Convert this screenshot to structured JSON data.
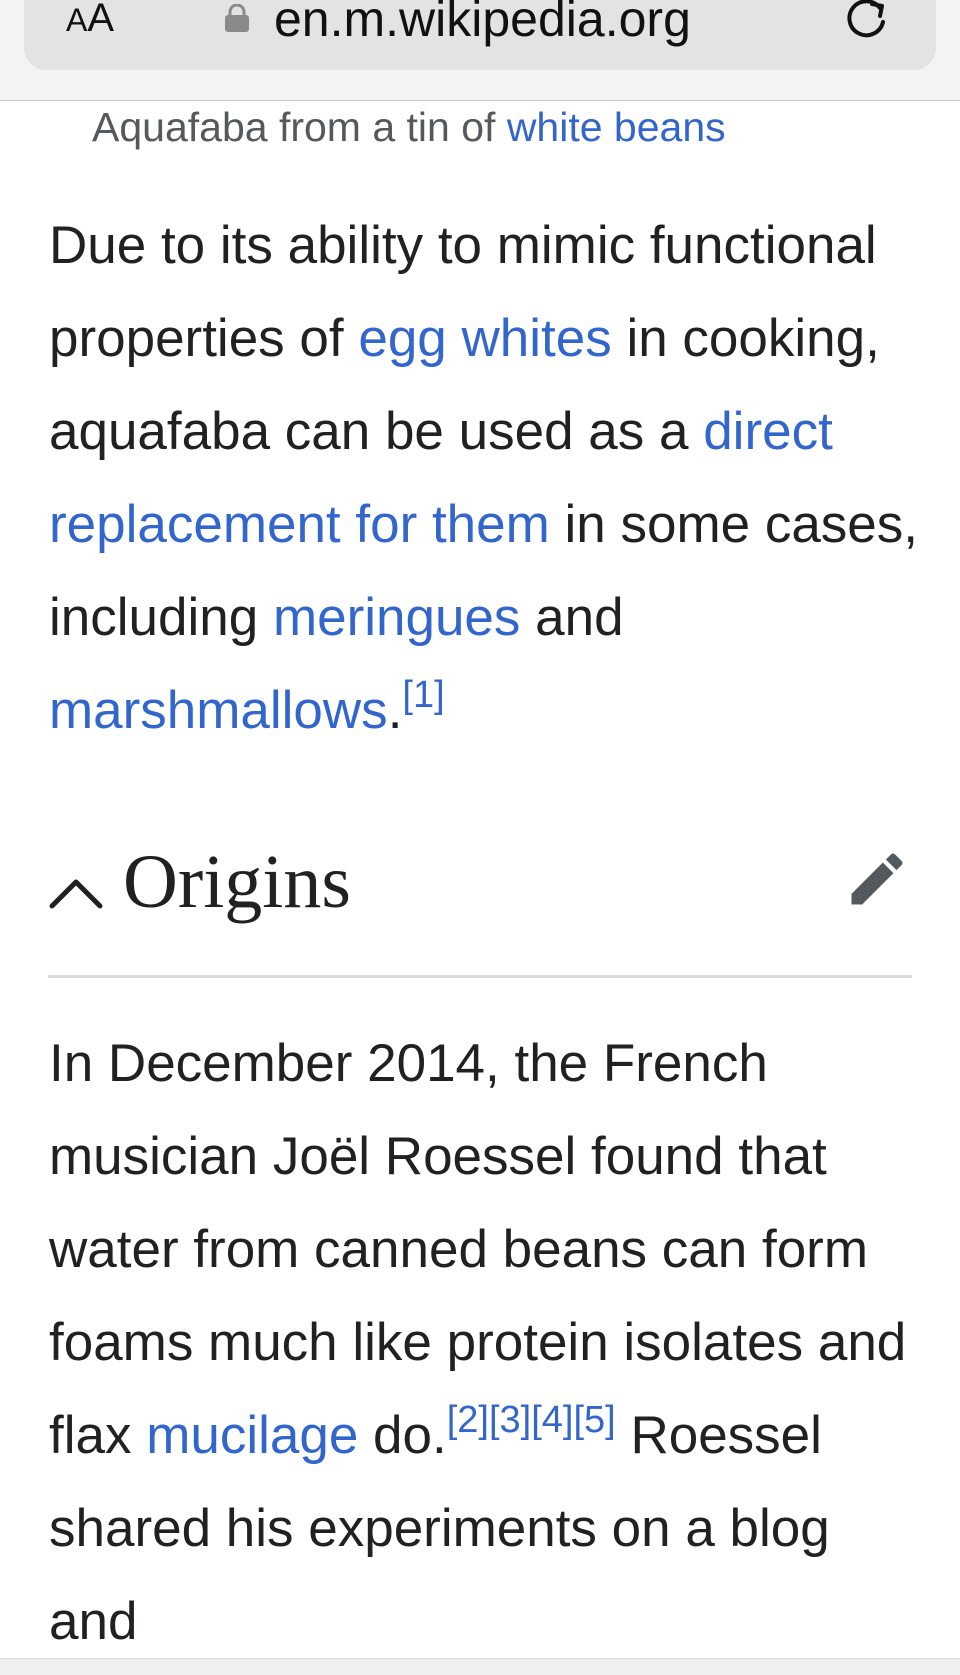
{
  "browser": {
    "aa_label_small": "A",
    "aa_label_large": "A",
    "url": "en.m.wikipedia.org"
  },
  "article": {
    "caption": {
      "prefix": "Aquafaba from a tin of ",
      "link": "white beans"
    },
    "para1": {
      "t1": "Due to its ability to mimic functional properties of ",
      "l1": "egg whites",
      "t2": " in cooking, aquafaba can be used as a ",
      "l2": "direct replacement for them",
      "t3": " in some cases, including ",
      "l3": "meringues",
      "t4": " and ",
      "l4": "marshmallows",
      "t5": ".",
      "ref1": "[1]"
    },
    "section": {
      "title": "Origins"
    },
    "para2": {
      "t1": "In December 2014, the French musician Joël Roessel found that water from canned beans can form foams much like protein isolates and flax ",
      "l1": "mucilage",
      "t2": " do.",
      "ref2": "[2]",
      "ref3": "[3]",
      "ref4": "[4]",
      "ref5": "[5]",
      "t3": " Roessel shared his experiments on a blog and"
    }
  }
}
